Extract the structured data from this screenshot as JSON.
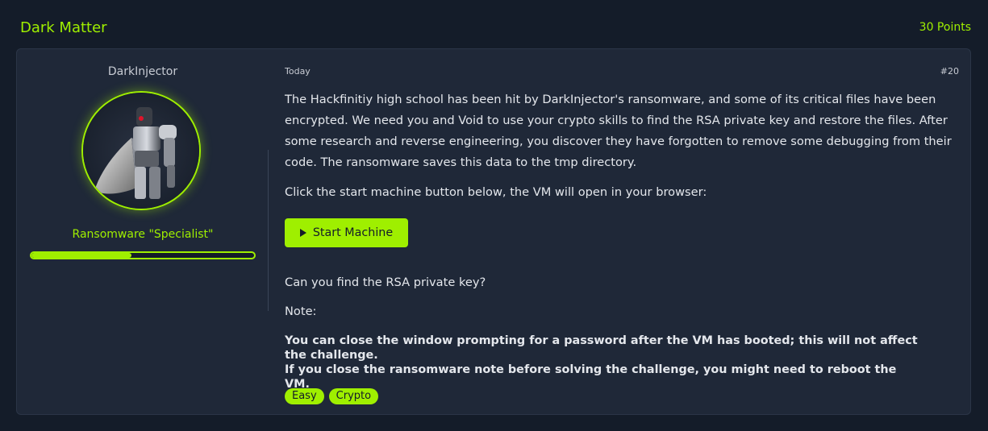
{
  "task": {
    "title": "Dark Matter",
    "points": "30 Points"
  },
  "author": {
    "name": "DarkInjector",
    "rank": "Ransomware \"Specialist\"",
    "progress_fraction": 0.45
  },
  "post": {
    "date": "Today",
    "number": "#20",
    "description": "The Hackfinitiy high school has been hit by DarkInjector's ransomware, and some of its critical files have been encrypted. We need you and Void to use your crypto skills to find the RSA private key and restore the files. After some research and reverse engineering, you discover they have forgotten to remove some debugging from their code. The ransomware saves this data to the tmp directory.",
    "instruction": "Click the start machine button below, the VM will open in your browser:",
    "start_button_label": "Start Machine",
    "question": "Can you find the RSA private key?",
    "note_label": "Note:",
    "note_line1": "You can close the window prompting for a password after the VM has booted; this will not affect the challenge.",
    "note_line2": "If you close the ransomware note before solving the challenge, you might need to reboot the VM."
  },
  "tags": [
    "Easy",
    "Crypto"
  ],
  "colors": {
    "accent": "#9fef00",
    "background": "#141c29",
    "card": "#1f2838"
  },
  "icons": {
    "start_button": "play-icon"
  }
}
